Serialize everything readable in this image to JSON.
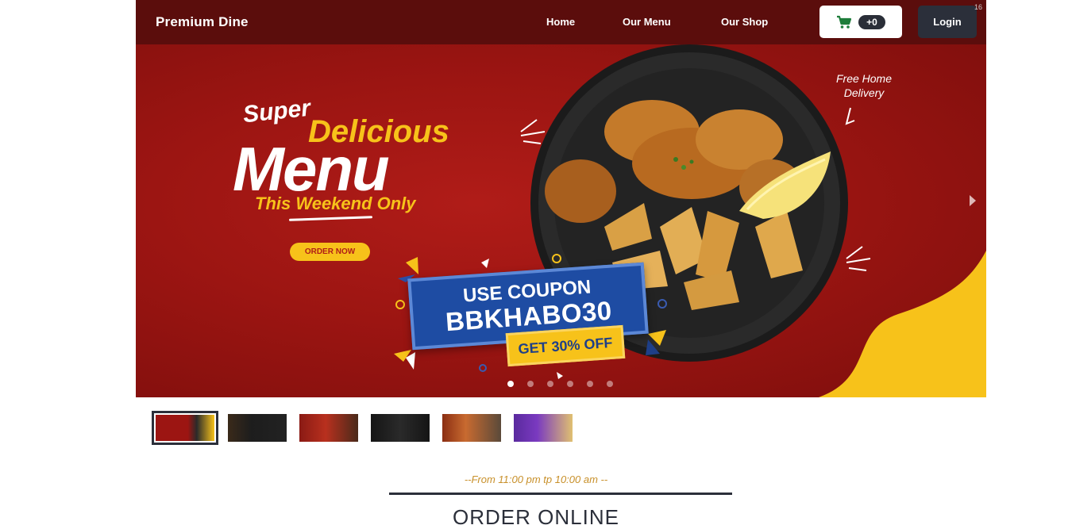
{
  "navbar": {
    "brand": "Premium Dine",
    "links": [
      {
        "label": "Home"
      },
      {
        "label": "Our Menu"
      },
      {
        "label": "Our Shop"
      }
    ],
    "cart": {
      "icon": "shopping-cart-icon",
      "count_label": "+0",
      "icon_color": "#1e7d3a"
    },
    "login_label": "Login",
    "corner_number": "16"
  },
  "hero": {
    "headline": {
      "super": "Super",
      "delicious": "Delicious",
      "menu": "Menu",
      "weekend": "This Weekend Only"
    },
    "order_now_label": "ORDER NOW",
    "free_delivery_line1": "Free Home",
    "free_delivery_line2": "Delivery",
    "coupon": {
      "label": "USE COUPON",
      "code": "BBKHABO30",
      "offer": "GET 30% OFF"
    },
    "colors": {
      "background": "#9c1512",
      "accent": "#f7c21a",
      "coupon_blue": "#1e4ca3"
    },
    "slide_count": 6,
    "active_slide": 1
  },
  "thumbnails": [
    {
      "name": "slide-1",
      "color": "#9c1512",
      "selected": true
    },
    {
      "name": "slide-2",
      "color": "#1d1d1d"
    },
    {
      "name": "slide-3",
      "color": "#8a1a14"
    },
    {
      "name": "slide-4",
      "color": "#151515"
    },
    {
      "name": "slide-5",
      "color": "#8b2e12"
    },
    {
      "name": "slide-6",
      "color": "#5a2a9e"
    }
  ],
  "section": {
    "hours": "--From 11:00 pm tp 10:00 am --",
    "title": "ORDER ONLINE"
  }
}
